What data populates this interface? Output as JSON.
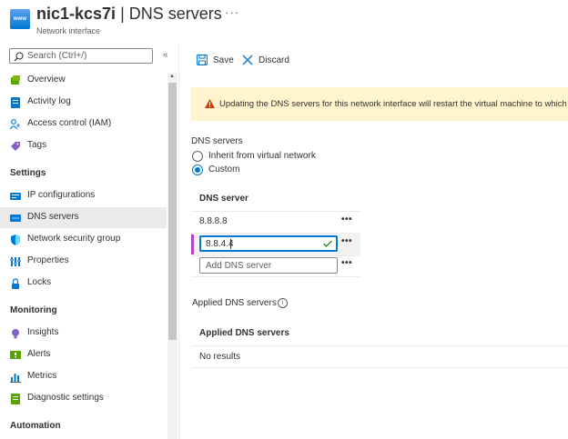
{
  "header": {
    "icon_text": "www",
    "title_resource": "nic1-kcs7i",
    "title_separator": "|",
    "title_page": "DNS servers",
    "subtitle": "Network interface",
    "more": "···"
  },
  "sidebar": {
    "search_placeholder": "Search (Ctrl+/)",
    "collapse": "«",
    "items": [
      {
        "label": "Overview",
        "icon": "overview-icon"
      },
      {
        "label": "Activity log",
        "icon": "activity-log-icon"
      },
      {
        "label": "Access control (IAM)",
        "icon": "iam-icon"
      },
      {
        "label": "Tags",
        "icon": "tag-icon"
      }
    ],
    "settings_heading": "Settings",
    "settings_items": [
      {
        "label": "IP configurations",
        "icon": "ip-config-icon"
      },
      {
        "label": "DNS servers",
        "icon": "dns-icon",
        "selected": true
      },
      {
        "label": "Network security group",
        "icon": "shield-icon"
      },
      {
        "label": "Properties",
        "icon": "properties-icon"
      },
      {
        "label": "Locks",
        "icon": "lock-icon"
      }
    ],
    "monitoring_heading": "Monitoring",
    "monitoring_items": [
      {
        "label": "Insights",
        "icon": "insights-icon"
      },
      {
        "label": "Alerts",
        "icon": "alerts-icon"
      },
      {
        "label": "Metrics",
        "icon": "metrics-icon"
      },
      {
        "label": "Diagnostic settings",
        "icon": "diagnostic-icon"
      }
    ],
    "automation_heading": "Automation"
  },
  "toolbar": {
    "save_label": "Save",
    "discard_label": "Discard"
  },
  "warning": {
    "text": "Updating the DNS servers for this network interface will restart the virtual machine to which it's a"
  },
  "dns_form": {
    "label": "DNS servers",
    "option_inherit": "Inherit from virtual network",
    "option_custom": "Custom",
    "selected": "Custom",
    "grid_header": "DNS server",
    "rows": [
      {
        "value": "8.8.8.8"
      },
      {
        "value": "8.8.4.4"
      }
    ],
    "add_placeholder": "Add DNS server",
    "row_menu": "•••"
  },
  "applied": {
    "label": "Applied DNS servers",
    "info": "i",
    "grid_header": "Applied DNS servers",
    "empty_text": "No results"
  },
  "colors": {
    "accent": "#0078d4",
    "warning_bg": "#fff4ce",
    "selected_bar": "#b146c2"
  }
}
